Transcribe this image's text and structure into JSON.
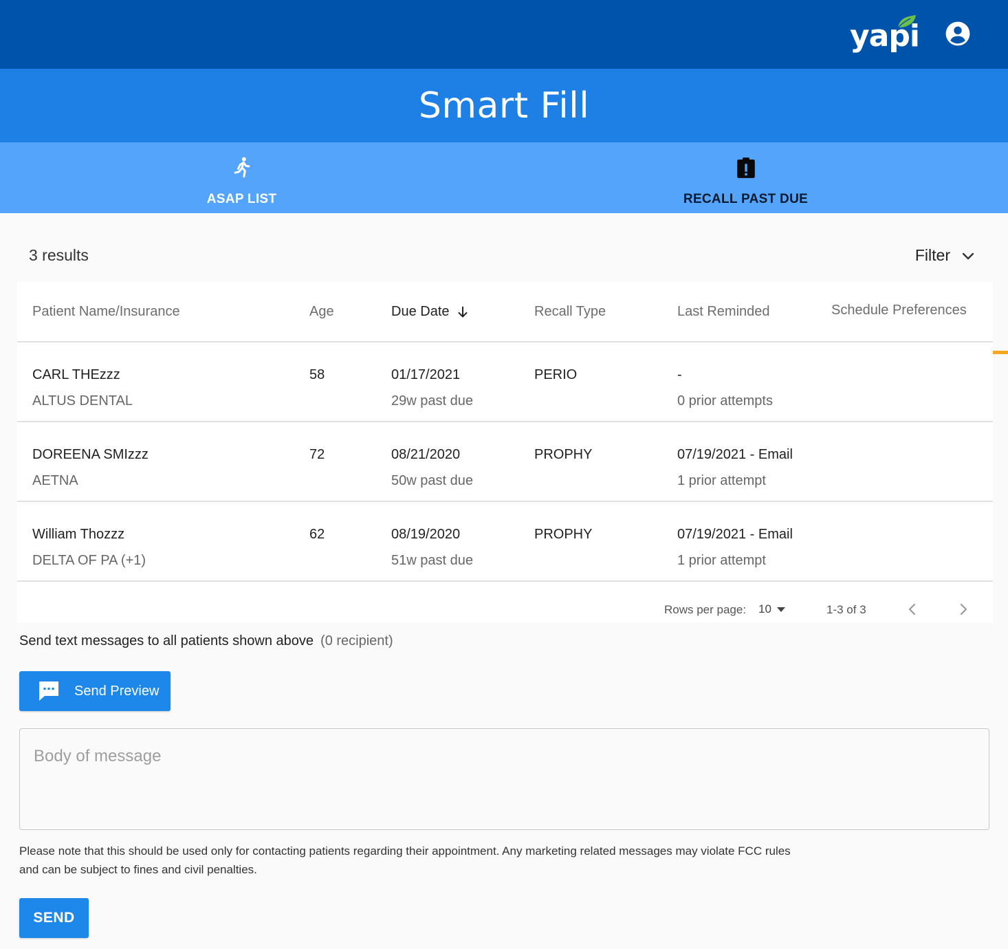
{
  "header": {
    "logo_text": "yapi",
    "brand_color": "#0053aa",
    "leaf_color": "#6cc04a"
  },
  "title": "Smart Fill",
  "tabs": [
    {
      "label": "ASAP LIST",
      "icon": "running-person-icon",
      "selected": false
    },
    {
      "label": "RECALL PAST DUE",
      "icon": "clipboard-alert-icon",
      "selected": true
    }
  ],
  "results": {
    "count_label": "3 results",
    "filter_label": "Filter"
  },
  "table": {
    "columns": [
      {
        "label": "Patient Name/Insurance"
      },
      {
        "label": "Age"
      },
      {
        "label": "Due Date",
        "sorted": "desc"
      },
      {
        "label": "Recall Type"
      },
      {
        "label": "Last Reminded"
      },
      {
        "label": "Schedule Preferences"
      }
    ],
    "rows": [
      {
        "name": "CARL THEzzz",
        "insurance": "ALTUS DENTAL",
        "age": "58",
        "due_date": "01/17/2021",
        "past_due": "29w past due",
        "recall_type": "PERIO",
        "last_reminded": "-",
        "attempts": "0 prior attempts",
        "preferences": ""
      },
      {
        "name": "DOREENA SMIzzz",
        "insurance": "AETNA",
        "age": "72",
        "due_date": "08/21/2020",
        "past_due": "50w past due",
        "recall_type": "PROPHY",
        "last_reminded": "07/19/2021 - Email",
        "attempts": "1 prior attempt",
        "preferences": ""
      },
      {
        "name": "William Thozzz",
        "insurance": "DELTA OF PA (+1)",
        "age": "62",
        "due_date": "08/19/2020",
        "past_due": "51w past due",
        "recall_type": "PROPHY",
        "last_reminded": "07/19/2021 - Email",
        "attempts": "1 prior attempt",
        "preferences": ""
      }
    ]
  },
  "pagination": {
    "rows_per_page_label": "Rows per page:",
    "rows_per_page_value": "10",
    "range_label": "1-3 of 3"
  },
  "messaging": {
    "send_all_label": "Send text messages to all patients shown above",
    "recipient_label": "(0 recipient)",
    "preview_button_label": "Send Preview",
    "body_placeholder": "Body of message",
    "body_value": "",
    "notice_line1": "Please note that this should be used only for contacting patients regarding their appointment. Any marketing related messages may violate FCC rules",
    "notice_line2": "and can be subject to fines and civil penalties.",
    "send_button_label": "SEND"
  },
  "colors": {
    "title_bar": "#1e7fe5",
    "tab_bar": "#55a4fb",
    "tab_indicator": "#f5a623",
    "button": "#1e88ea"
  }
}
